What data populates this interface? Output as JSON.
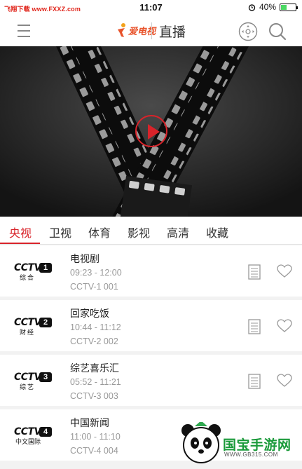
{
  "status_bar": {
    "left_text": "飞翔下载 www.FXXZ.com",
    "time": "11:07",
    "battery": "40%",
    "battery_level": 0.4
  },
  "navbar": {
    "logo_text": "爱电视",
    "title": "直播"
  },
  "tabs": [
    {
      "label": "央视",
      "active": true
    },
    {
      "label": "卫视",
      "active": false
    },
    {
      "label": "体育",
      "active": false
    },
    {
      "label": "影视",
      "active": false
    },
    {
      "label": "高清",
      "active": false
    },
    {
      "label": "收藏",
      "active": false
    }
  ],
  "channels": [
    {
      "logo": "CCTV",
      "number": "1",
      "logo_sub": "综合",
      "program": "电视剧",
      "time": "09:23 - 12:00",
      "channel": "CCTV-1 001"
    },
    {
      "logo": "CCTV",
      "number": "2",
      "logo_sub": "财经",
      "program": "回家吃饭",
      "time": "10:44 - 11:12",
      "channel": "CCTV-2 002"
    },
    {
      "logo": "CCTV",
      "number": "3",
      "logo_sub": "综艺",
      "program": "综艺喜乐汇",
      "time": "05:52 - 11:21",
      "channel": "CCTV-3 003"
    },
    {
      "logo": "CCTV",
      "number": "4",
      "logo_sub": "中文国际",
      "program": "中国新闻",
      "time": "11:00 - 11:10",
      "channel": "CCTV-4 004"
    }
  ],
  "watermark": {
    "text": "国宝手游网",
    "url": "WWW.GB315.COM"
  },
  "colors": {
    "accent": "#d8232a",
    "logo_orange": "#e8532b",
    "muted_text": "#999999"
  }
}
